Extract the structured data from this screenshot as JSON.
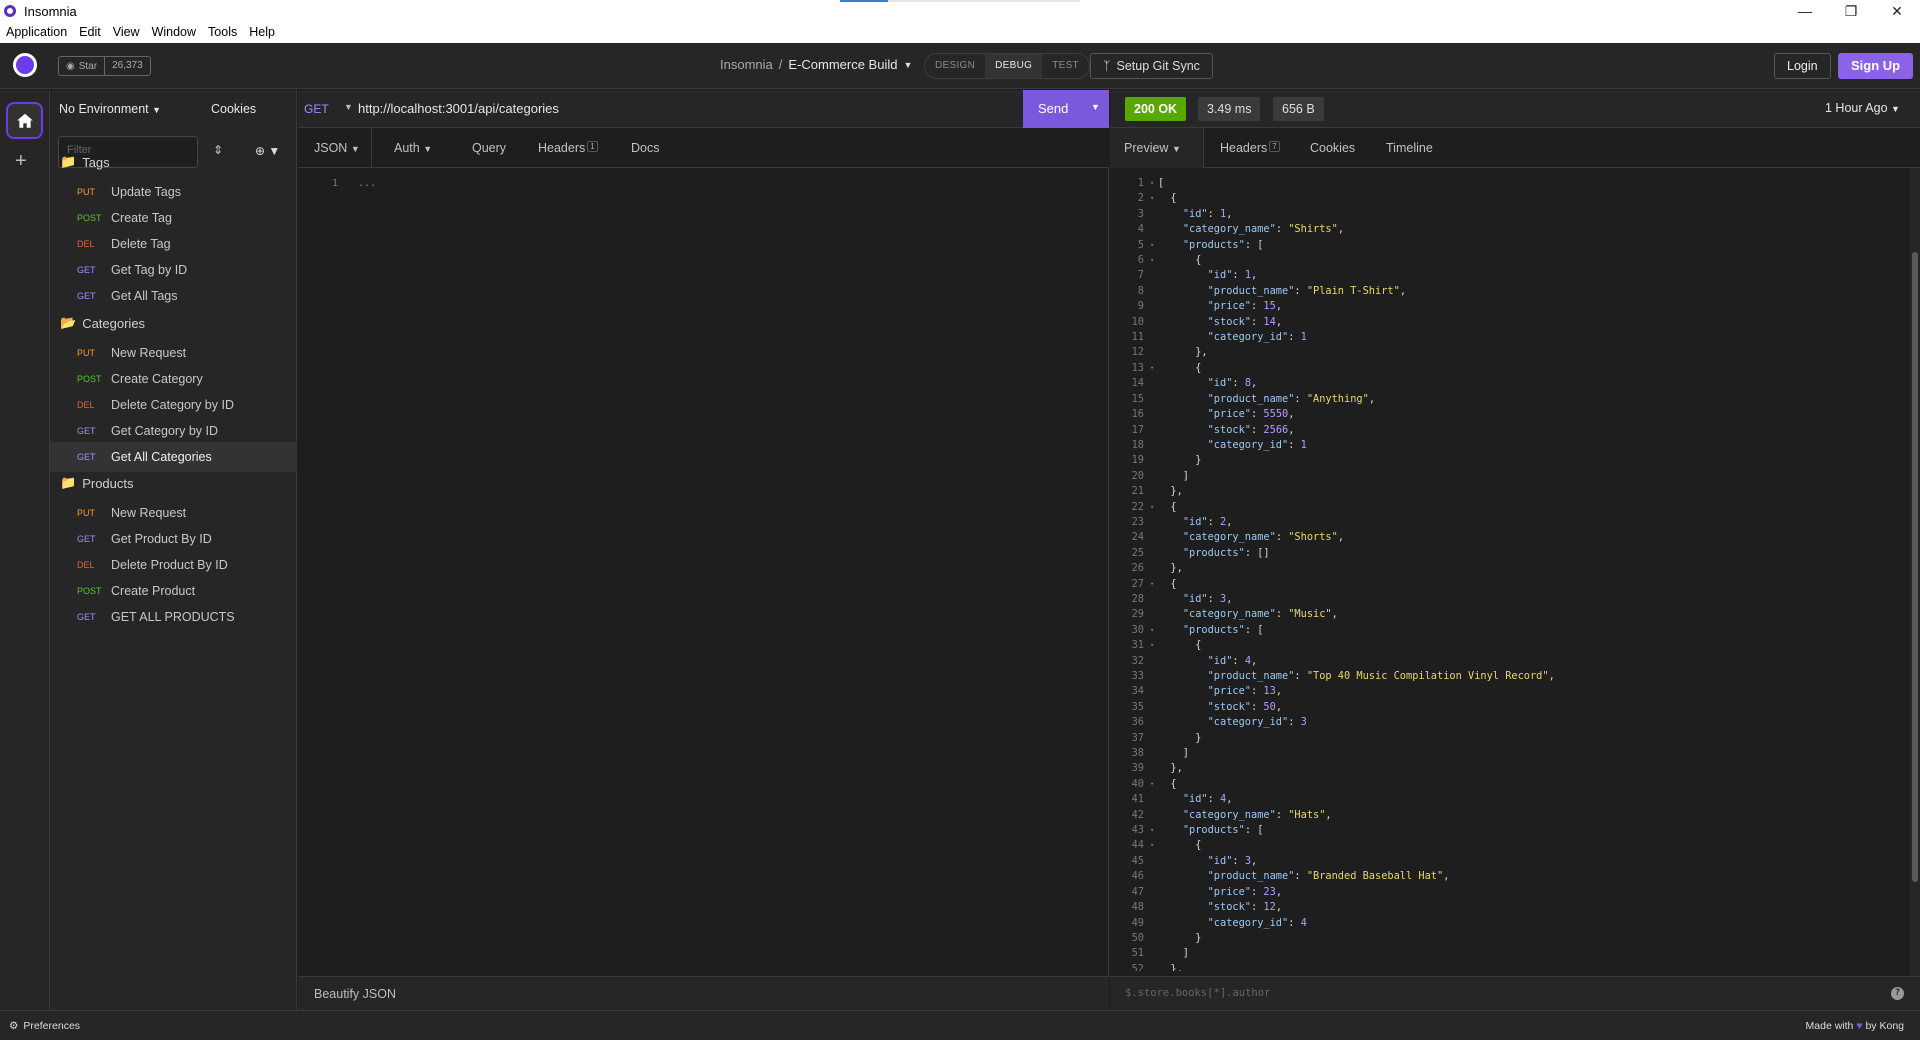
{
  "window": {
    "title": "Insomnia",
    "menus": [
      "Application",
      "Edit",
      "View",
      "Window",
      "Tools",
      "Help"
    ]
  },
  "appbar": {
    "star_label": "Star",
    "star_count": "26,373",
    "breadcrumb_root": "Insomnia",
    "breadcrumb_sep": "/",
    "project": "E-Commerce Build",
    "modes": [
      "DESIGN",
      "DEBUG",
      "TEST"
    ],
    "active_mode": "DEBUG",
    "git_sync": "Setup Git Sync",
    "login": "Login",
    "signup": "Sign Up",
    "accent": "#7c59dc"
  },
  "sidebar": {
    "environment": "No Environment",
    "cookies": "Cookies",
    "filter_placeholder": "Filter",
    "folders": [
      {
        "name": "Tags",
        "requests": [
          {
            "method": "PUT",
            "name": "Update Tags"
          },
          {
            "method": "POST",
            "name": "Create Tag"
          },
          {
            "method": "DEL",
            "name": "Delete Tag"
          },
          {
            "method": "GET",
            "name": "Get Tag by ID"
          },
          {
            "method": "GET",
            "name": "Get All Tags"
          }
        ]
      },
      {
        "name": "Categories",
        "requests": [
          {
            "method": "PUT",
            "name": "New Request"
          },
          {
            "method": "POST",
            "name": "Create Category"
          },
          {
            "method": "DEL",
            "name": "Delete Category by ID"
          },
          {
            "method": "GET",
            "name": "Get Category by ID"
          },
          {
            "method": "GET",
            "name": "Get All Categories"
          }
        ]
      },
      {
        "name": "Products",
        "requests": [
          {
            "method": "PUT",
            "name": "New Request"
          },
          {
            "method": "GET",
            "name": "Get Product By ID"
          },
          {
            "method": "DEL",
            "name": "Delete Product By ID"
          },
          {
            "method": "POST",
            "name": "Create Product"
          },
          {
            "method": "GET",
            "name": "GET ALL PRODUCTS"
          }
        ]
      }
    ],
    "active_request": "Get All Categories",
    "method_colors": {
      "PUT": "#ff9a1f",
      "POST": "#59c42b",
      "DEL": "#f05a3a",
      "GET": "#a78bff"
    }
  },
  "request": {
    "method": "GET",
    "url": "http://localhost:3001/api/categories",
    "send": "Send",
    "tabs": {
      "body": "JSON",
      "auth": "Auth",
      "query": "Query",
      "headers": "Headers",
      "headers_count": "1",
      "docs": "Docs"
    },
    "editor_line_number": "1",
    "editor_placeholder": "...",
    "footer": "Beautify JSON"
  },
  "response": {
    "status": "200 OK",
    "time": "3.49 ms",
    "size": "656 B",
    "time_ago": "1 Hour Ago",
    "tabs": {
      "preview": "Preview",
      "headers": "Headers",
      "headers_count": "7",
      "cookies": "Cookies",
      "timeline": "Timeline"
    },
    "filter_placeholder": "$.store.books[*].author",
    "help": "?",
    "lines": [
      "[",
      "  {",
      "    \"id\": 1,",
      "    \"category_name\": \"Shirts\",",
      "    \"products\": [",
      "      {",
      "        \"id\": 1,",
      "        \"product_name\": \"Plain T-Shirt\",",
      "        \"price\": 15,",
      "        \"stock\": 14,",
      "        \"category_id\": 1",
      "      },",
      "      {",
      "        \"id\": 8,",
      "        \"product_name\": \"Anything\",",
      "        \"price\": 5550,",
      "        \"stock\": 2566,",
      "        \"category_id\": 1",
      "      }",
      "    ]",
      "  },",
      "  {",
      "    \"id\": 2,",
      "    \"category_name\": \"Shorts\",",
      "    \"products\": []",
      "  },",
      "  {",
      "    \"id\": 3,",
      "    \"category_name\": \"Music\",",
      "    \"products\": [",
      "      {",
      "        \"id\": 4,",
      "        \"product_name\": \"Top 40 Music Compilation Vinyl Record\",",
      "        \"price\": 13,",
      "        \"stock\": 50,",
      "        \"category_id\": 3",
      "      }",
      "    ]",
      "  },",
      "  {",
      "    \"id\": 4,",
      "    \"category_name\": \"Hats\",",
      "    \"products\": [",
      "      {",
      "        \"id\": 3,",
      "        \"product_name\": \"Branded Baseball Hat\",",
      "        \"price\": 23,",
      "        \"stock\": 12,",
      "        \"category_id\": 4",
      "      }",
      "    ]",
      "  },"
    ],
    "fold_lines": [
      1,
      2,
      5,
      6,
      13,
      22,
      27,
      30,
      31,
      40,
      43,
      44
    ]
  },
  "footer": {
    "preferences": "Preferences",
    "made_with": "Made with",
    "by": "by Kong"
  }
}
